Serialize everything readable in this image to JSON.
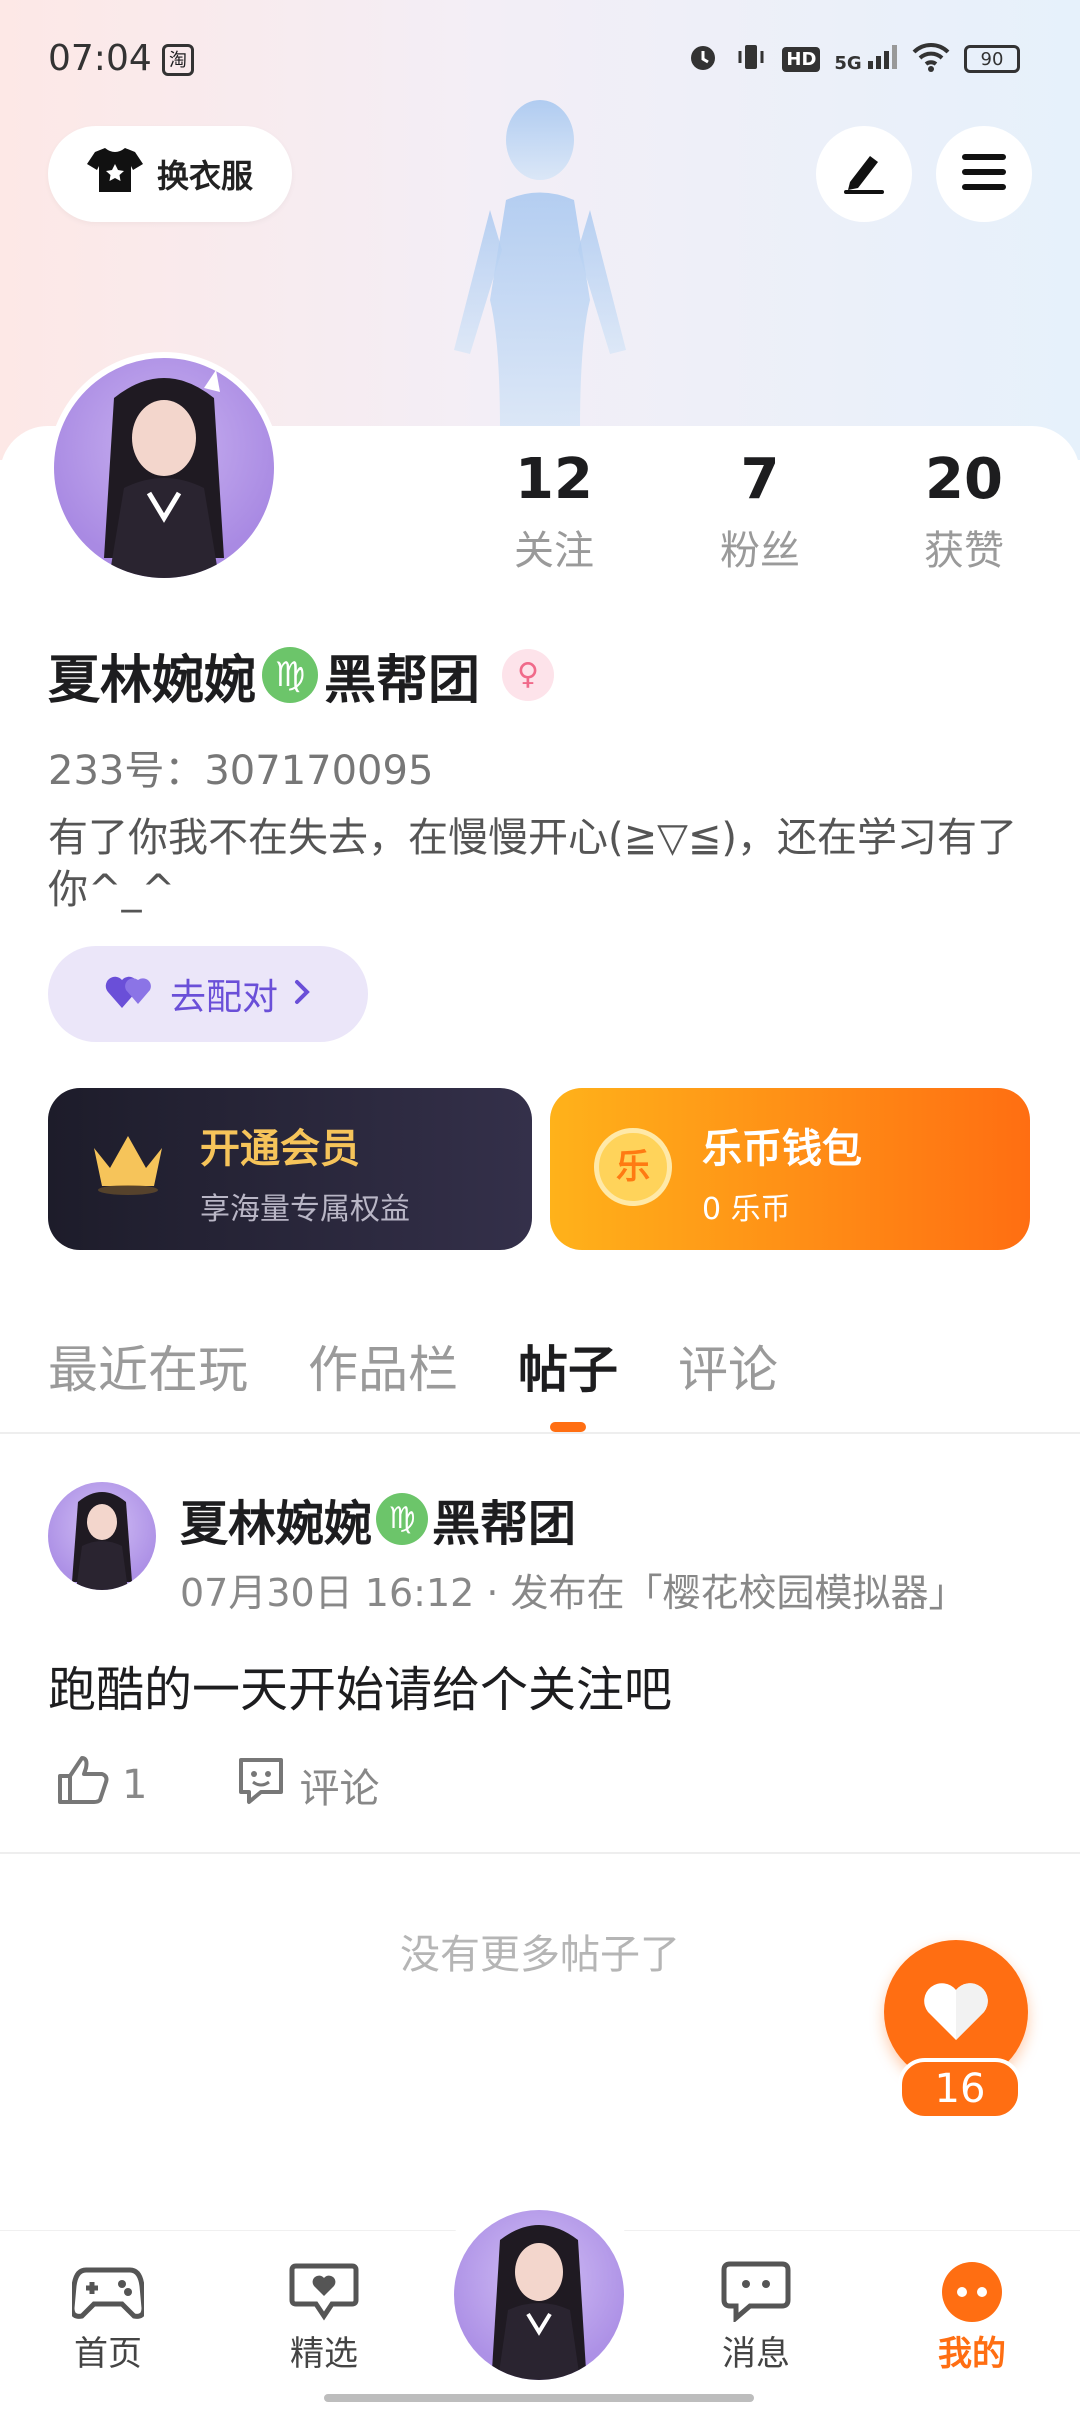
{
  "status_bar": {
    "time": "07:04",
    "app_icon_label": "淘",
    "network": "5G",
    "hd": "HD",
    "battery": "90"
  },
  "header": {
    "dress_button_label": "换衣服",
    "edit_icon": "pen-icon",
    "menu_icon": "menu-icon"
  },
  "profile": {
    "stats": [
      {
        "count": "12",
        "label": "关注"
      },
      {
        "count": "7",
        "label": "粉丝"
      },
      {
        "count": "20",
        "label": "获赞"
      }
    ],
    "name_part1": "夏林婉婉",
    "zodiac_symbol": "♍",
    "name_part2": "黑帮团",
    "gender_symbol": "♀",
    "uid": "233号：307170095",
    "bio": "有了你我不在失去，在慢慢开心(≧▽≦)，还在学习有了你^_^",
    "match_label": "去配对"
  },
  "promo_cards": {
    "vip": {
      "title": "开通会员",
      "subtitle": "享海量专属权益"
    },
    "wallet": {
      "title": "乐币钱包",
      "subtitle": "0  乐币",
      "coin_char": "乐"
    }
  },
  "tabs": [
    "最近在玩",
    "作品栏",
    "帖子",
    "评论"
  ],
  "active_tab": "帖子",
  "post": {
    "author_part1": "夏林婉婉",
    "zodiac_symbol": "♍",
    "author_part2": "黑帮团",
    "meta": "07月30日  16:12 · 发布在「樱花校园模拟器」",
    "text": "跑酷的一天开始请给个关注吧",
    "like_count": "1",
    "comment_label": "评论"
  },
  "no_more_text": "没有更多帖子了",
  "like_fab_count": "16",
  "bottom_nav": [
    {
      "label": "首页",
      "icon": "gamepad-icon"
    },
    {
      "label": "精选",
      "icon": "heart-chat-icon"
    },
    {
      "label": "消息",
      "icon": "message-icon"
    },
    {
      "label": "我的",
      "icon": "me-icon"
    }
  ],
  "colors": {
    "accent": "#ff6e12",
    "match_purple": "#6a4fd8",
    "vip_gold": "#f6c45a"
  }
}
